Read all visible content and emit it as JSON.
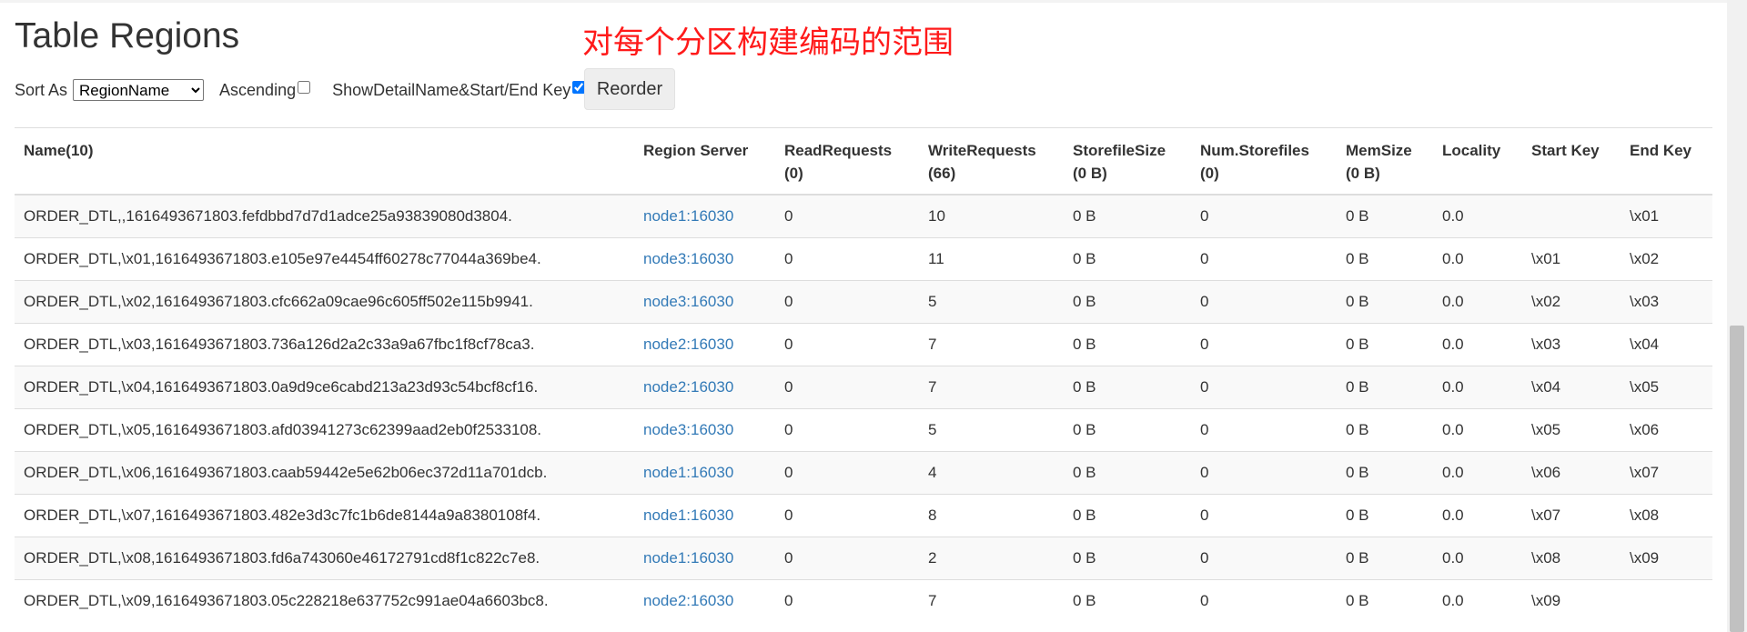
{
  "page": {
    "title": "Table Regions",
    "annotation": "对每个分区构建编码的范围"
  },
  "controls": {
    "sort_label": "Sort As",
    "sort_value": "RegionName",
    "ascending_label": "Ascending",
    "ascending_checked": false,
    "show_detail_label": "ShowDetailName&Start/End Key",
    "show_detail_checked": true,
    "reorder_label": "Reorder"
  },
  "table": {
    "headers": {
      "name": "Name(10)",
      "region_server": "Region Server",
      "read_requests": "ReadRequests",
      "read_requests_total": "(0)",
      "write_requests": "WriteRequests",
      "write_requests_total": "(66)",
      "storefile_size": "StorefileSize",
      "storefile_size_total": "(0 B)",
      "num_storefiles": "Num.Storefiles",
      "num_storefiles_total": "(0)",
      "memsize": "MemSize",
      "memsize_total": "(0 B)",
      "locality": "Locality",
      "start_key": "Start Key",
      "end_key": "End Key"
    },
    "rows": [
      {
        "name": "ORDER_DTL,,1616493671803.fefdbbd7d7d1adce25a93839080d3804.",
        "server": "node1:16030",
        "read": "0",
        "write": "10",
        "storefile_size": "0 B",
        "num_storefiles": "0",
        "memsize": "0 B",
        "locality": "0.0",
        "start_key": "",
        "end_key": "\\x01"
      },
      {
        "name": "ORDER_DTL,\\x01,1616493671803.e105e97e4454ff60278c77044a369be4.",
        "server": "node3:16030",
        "read": "0",
        "write": "11",
        "storefile_size": "0 B",
        "num_storefiles": "0",
        "memsize": "0 B",
        "locality": "0.0",
        "start_key": "\\x01",
        "end_key": "\\x02"
      },
      {
        "name": "ORDER_DTL,\\x02,1616493671803.cfc662a09cae96c605ff502e115b9941.",
        "server": "node3:16030",
        "read": "0",
        "write": "5",
        "storefile_size": "0 B",
        "num_storefiles": "0",
        "memsize": "0 B",
        "locality": "0.0",
        "start_key": "\\x02",
        "end_key": "\\x03"
      },
      {
        "name": "ORDER_DTL,\\x03,1616493671803.736a126d2a2c33a9a67fbc1f8cf78ca3.",
        "server": "node2:16030",
        "read": "0",
        "write": "7",
        "storefile_size": "0 B",
        "num_storefiles": "0",
        "memsize": "0 B",
        "locality": "0.0",
        "start_key": "\\x03",
        "end_key": "\\x04"
      },
      {
        "name": "ORDER_DTL,\\x04,1616493671803.0a9d9ce6cabd213a23d93c54bcf8cf16.",
        "server": "node2:16030",
        "read": "0",
        "write": "7",
        "storefile_size": "0 B",
        "num_storefiles": "0",
        "memsize": "0 B",
        "locality": "0.0",
        "start_key": "\\x04",
        "end_key": "\\x05"
      },
      {
        "name": "ORDER_DTL,\\x05,1616493671803.afd03941273c62399aad2eb0f2533108.",
        "server": "node3:16030",
        "read": "0",
        "write": "5",
        "storefile_size": "0 B",
        "num_storefiles": "0",
        "memsize": "0 B",
        "locality": "0.0",
        "start_key": "\\x05",
        "end_key": "\\x06"
      },
      {
        "name": "ORDER_DTL,\\x06,1616493671803.caab59442e5e62b06ec372d11a701dcb.",
        "server": "node1:16030",
        "read": "0",
        "write": "4",
        "storefile_size": "0 B",
        "num_storefiles": "0",
        "memsize": "0 B",
        "locality": "0.0",
        "start_key": "\\x06",
        "end_key": "\\x07"
      },
      {
        "name": "ORDER_DTL,\\x07,1616493671803.482e3d3c7fc1b6de8144a9a8380108f4.",
        "server": "node1:16030",
        "read": "0",
        "write": "8",
        "storefile_size": "0 B",
        "num_storefiles": "0",
        "memsize": "0 B",
        "locality": "0.0",
        "start_key": "\\x07",
        "end_key": "\\x08"
      },
      {
        "name": "ORDER_DTL,\\x08,1616493671803.fd6a743060e46172791cd8f1c822c7e8.",
        "server": "node1:16030",
        "read": "0",
        "write": "2",
        "storefile_size": "0 B",
        "num_storefiles": "0",
        "memsize": "0 B",
        "locality": "0.0",
        "start_key": "\\x08",
        "end_key": "\\x09"
      },
      {
        "name": "ORDER_DTL,\\x09,1616493671803.05c228218e637752c991ae04a6603bc8.",
        "server": "node2:16030",
        "read": "0",
        "write": "7",
        "storefile_size": "0 B",
        "num_storefiles": "0",
        "memsize": "0 B",
        "locality": "0.0",
        "start_key": "\\x09",
        "end_key": ""
      }
    ]
  },
  "colors": {
    "link": "#337ab7",
    "annotation": "#ff1a1a",
    "stripe": "#f9f9f9",
    "border": "#dddddd"
  }
}
